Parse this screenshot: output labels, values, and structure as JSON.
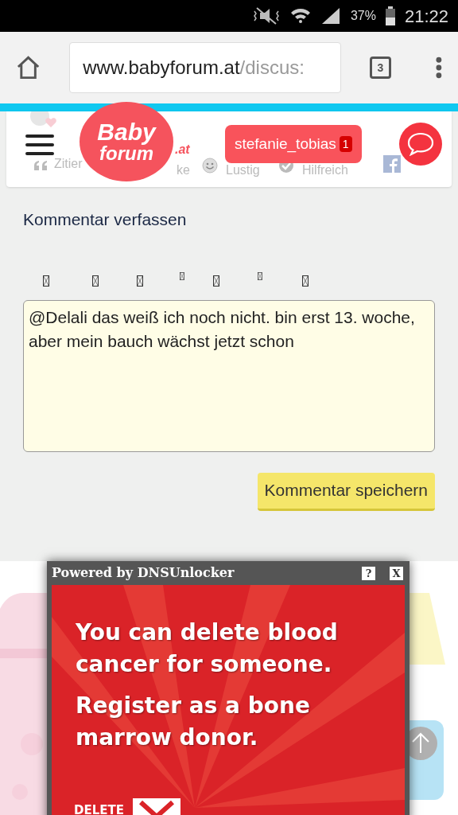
{
  "status_bar": {
    "battery": "37%",
    "time": "21:22"
  },
  "browser": {
    "url_host": "www.babyforum.at",
    "url_path": "/discus:",
    "tab_count": "3"
  },
  "header": {
    "logo": {
      "line1": "Baby",
      "line2": "forum",
      "suffix": ".at"
    },
    "reactions": [
      {
        "label": "Zitier"
      },
      {
        "label": "ke"
      },
      {
        "label": "Lustig"
      },
      {
        "label": "Hilfreich"
      }
    ],
    "user": {
      "name": "stefanie_tobias",
      "notifications": "1"
    }
  },
  "comment": {
    "heading": "Kommentar verfassen",
    "value": "@Delali das weiß ich noch nicht. bin erst 13. woche, aber mein bauch wächst jetzt schon",
    "save_button": "Kommentar speichern"
  },
  "popup": {
    "title": "Powered by DNSUnlocker",
    "help": "?",
    "close": "X",
    "ad_lines": [
      "You can delete blood cancer for someone.",
      "Register as a bone marrow donor."
    ],
    "ad_footer": "DELETE"
  }
}
